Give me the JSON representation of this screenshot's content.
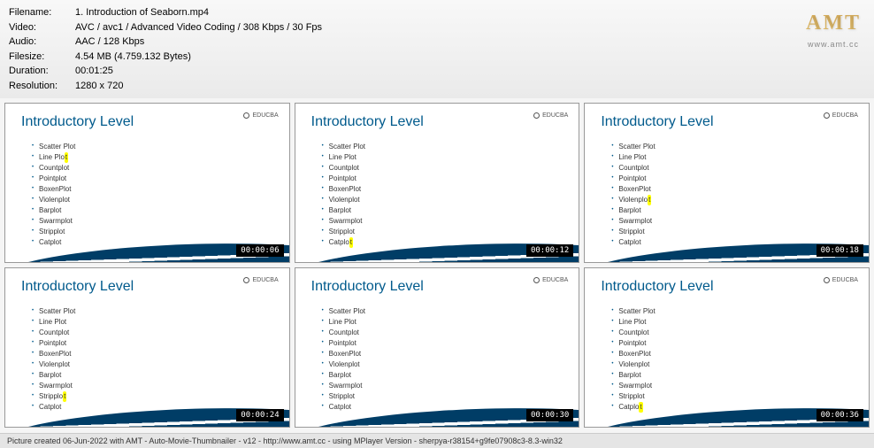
{
  "header": {
    "filename_label": "Filename:",
    "filename": "1. Introduction of Seaborn.mp4",
    "video_label": "Video:",
    "video": "AVC / avc1 / Advanced Video Coding / 308 Kbps / 30 Fps",
    "audio_label": "Audio:",
    "audio": "AAC / 128 Kbps",
    "filesize_label": "Filesize:",
    "filesize": "4.54 MB (4.759.132 Bytes)",
    "duration_label": "Duration:",
    "duration": "00:01:25",
    "resolution_label": "Resolution:",
    "resolution": "1280 x 720"
  },
  "amt": {
    "logo": "AMT",
    "url": "www.amt.cc"
  },
  "slide": {
    "title": "Introductory Level",
    "brand": "EDUCBA",
    "items": [
      "Scatter Plot",
      "Line Plot",
      "Countplot",
      "Pointplot",
      "BoxenPlot",
      "Violenplot",
      "Barplot",
      "Swarmplot",
      "Stripplot",
      "Catplot"
    ]
  },
  "thumbs": [
    {
      "ts": "00:00:06",
      "hl": 1
    },
    {
      "ts": "00:00:12",
      "hl": 9
    },
    {
      "ts": "00:00:18",
      "hl": 5
    },
    {
      "ts": "00:00:24",
      "hl": 8
    },
    {
      "ts": "00:00:30",
      "hl": -1
    },
    {
      "ts": "00:00:36",
      "hl": 9
    }
  ],
  "footer": "Picture created 06-Jun-2022 with AMT - Auto-Movie-Thumbnailer - v12 - http://www.amt.cc - using MPlayer Version - sherpya-r38154+g9fe07908c3-8.3-win32"
}
